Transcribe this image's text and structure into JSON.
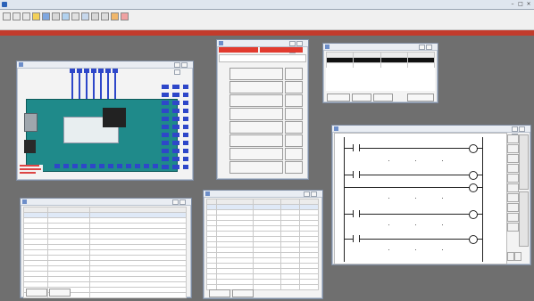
{
  "app": {
    "title": "",
    "mdi_title": ""
  },
  "windows": {
    "arduino": {
      "title": ""
    },
    "calculator": {
      "title": "",
      "header": [
        "",
        "",
        "",
        ""
      ],
      "columns": [
        "",
        "",
        "",
        ""
      ],
      "keys": [
        "",
        "",
        "",
        "",
        "",
        "",
        "",
        ""
      ]
    },
    "alarm_table": {
      "title": "",
      "columns": [
        "",
        "",
        "",
        ""
      ],
      "rows": [
        [
          "",
          "",
          "",
          ""
        ],
        [
          "",
          "",
          "",
          ""
        ]
      ],
      "buttons": [
        "",
        "",
        "",
        ""
      ]
    },
    "tag_table_left": {
      "title": "",
      "columns": [
        "",
        "",
        ""
      ],
      "rows": [
        [
          "",
          "",
          ""
        ],
        [
          "",
          "",
          ""
        ],
        [
          "",
          "",
          ""
        ],
        [
          "",
          "",
          ""
        ],
        [
          "",
          "",
          ""
        ],
        [
          "",
          "",
          ""
        ],
        [
          "",
          "",
          ""
        ],
        [
          "",
          "",
          ""
        ],
        [
          "",
          "",
          ""
        ],
        [
          "",
          "",
          ""
        ],
        [
          "",
          "",
          ""
        ],
        [
          "",
          "",
          ""
        ],
        [
          "",
          "",
          ""
        ],
        [
          "",
          "",
          ""
        ],
        [
          "",
          "",
          ""
        ],
        [
          "",
          "",
          ""
        ]
      ],
      "buttons": [
        "",
        ""
      ]
    },
    "tag_table_right": {
      "title": "",
      "columns": [
        "",
        "",
        "",
        "",
        ""
      ],
      "rows": [
        [
          "",
          "",
          "",
          "",
          ""
        ],
        [
          "",
          "",
          "",
          "",
          ""
        ],
        [
          "",
          "",
          "",
          "",
          ""
        ],
        [
          "",
          "",
          "",
          "",
          ""
        ],
        [
          "",
          "",
          "",
          "",
          ""
        ],
        [
          "",
          "",
          "",
          "",
          ""
        ],
        [
          "",
          "",
          "",
          "",
          ""
        ],
        [
          "",
          "",
          "",
          "",
          ""
        ],
        [
          "",
          "",
          "",
          "",
          ""
        ],
        [
          "",
          "",
          "",
          "",
          ""
        ],
        [
          "",
          "",
          "",
          "",
          ""
        ],
        [
          "",
          "",
          "",
          "",
          ""
        ],
        [
          "",
          "",
          "",
          "",
          ""
        ],
        [
          "",
          "",
          "",
          "",
          ""
        ],
        [
          "",
          "",
          "",
          "",
          ""
        ],
        [
          "",
          "",
          "",
          "",
          ""
        ]
      ],
      "buttons": [
        "",
        ""
      ]
    },
    "ladder": {
      "title": "",
      "rungs": [
        "",
        "",
        "",
        "",
        ""
      ],
      "side_tabs": [
        "",
        ""
      ]
    }
  },
  "colors": {
    "workspace": "#6f6f6f",
    "mdi_bar": "#c23b2c",
    "arduino_board": "#1f8a8a",
    "pin_blue": "#2e47c9",
    "ladder_text": "#0a7a0a"
  }
}
